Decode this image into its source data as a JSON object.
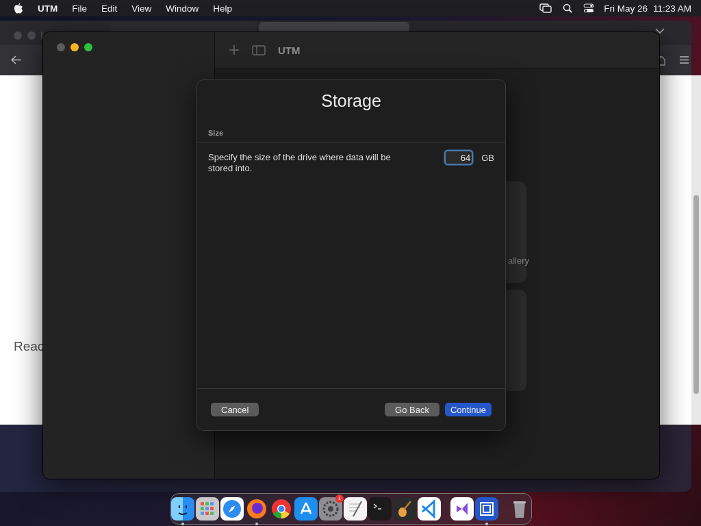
{
  "menu_bar": {
    "app_name": "UTM",
    "menus": [
      "File",
      "Edit",
      "View",
      "Window",
      "Help"
    ],
    "date": "Fri May 26",
    "time": "11:23 AM"
  },
  "background_page": {
    "heading": "Reac",
    "card_label": "allery"
  },
  "utm_window": {
    "title": "UTM"
  },
  "dialog": {
    "title": "Storage",
    "section": "Size",
    "description": "Specify the size of the drive where data will be stored into.",
    "size_value": "64",
    "unit": "GB",
    "buttons": [
      {
        "label": "Cancel",
        "kind": "secondary"
      },
      {
        "label": "Go Back",
        "kind": "secondary"
      },
      {
        "label": "Continue",
        "kind": "primary"
      }
    ]
  },
  "dock": {
    "groups": [
      [
        {
          "kind": "finder",
          "running": true
        },
        {
          "kind": "launchpad",
          "running": false
        },
        {
          "kind": "safari",
          "running": false
        },
        {
          "kind": "firefox",
          "running": true
        },
        {
          "kind": "chrome",
          "running": false
        },
        {
          "kind": "appstore",
          "running": false
        },
        {
          "kind": "settings",
          "running": false,
          "badge": "1"
        },
        {
          "kind": "textedit",
          "running": false
        },
        {
          "kind": "terminal",
          "running": false
        },
        {
          "kind": "garageband",
          "running": false
        },
        {
          "kind": "vscode",
          "running": false
        }
      ],
      [
        {
          "kind": "visualstudio",
          "running": false
        },
        {
          "kind": "utm",
          "running": true
        }
      ],
      [
        {
          "kind": "trash",
          "running": false
        }
      ]
    ]
  }
}
